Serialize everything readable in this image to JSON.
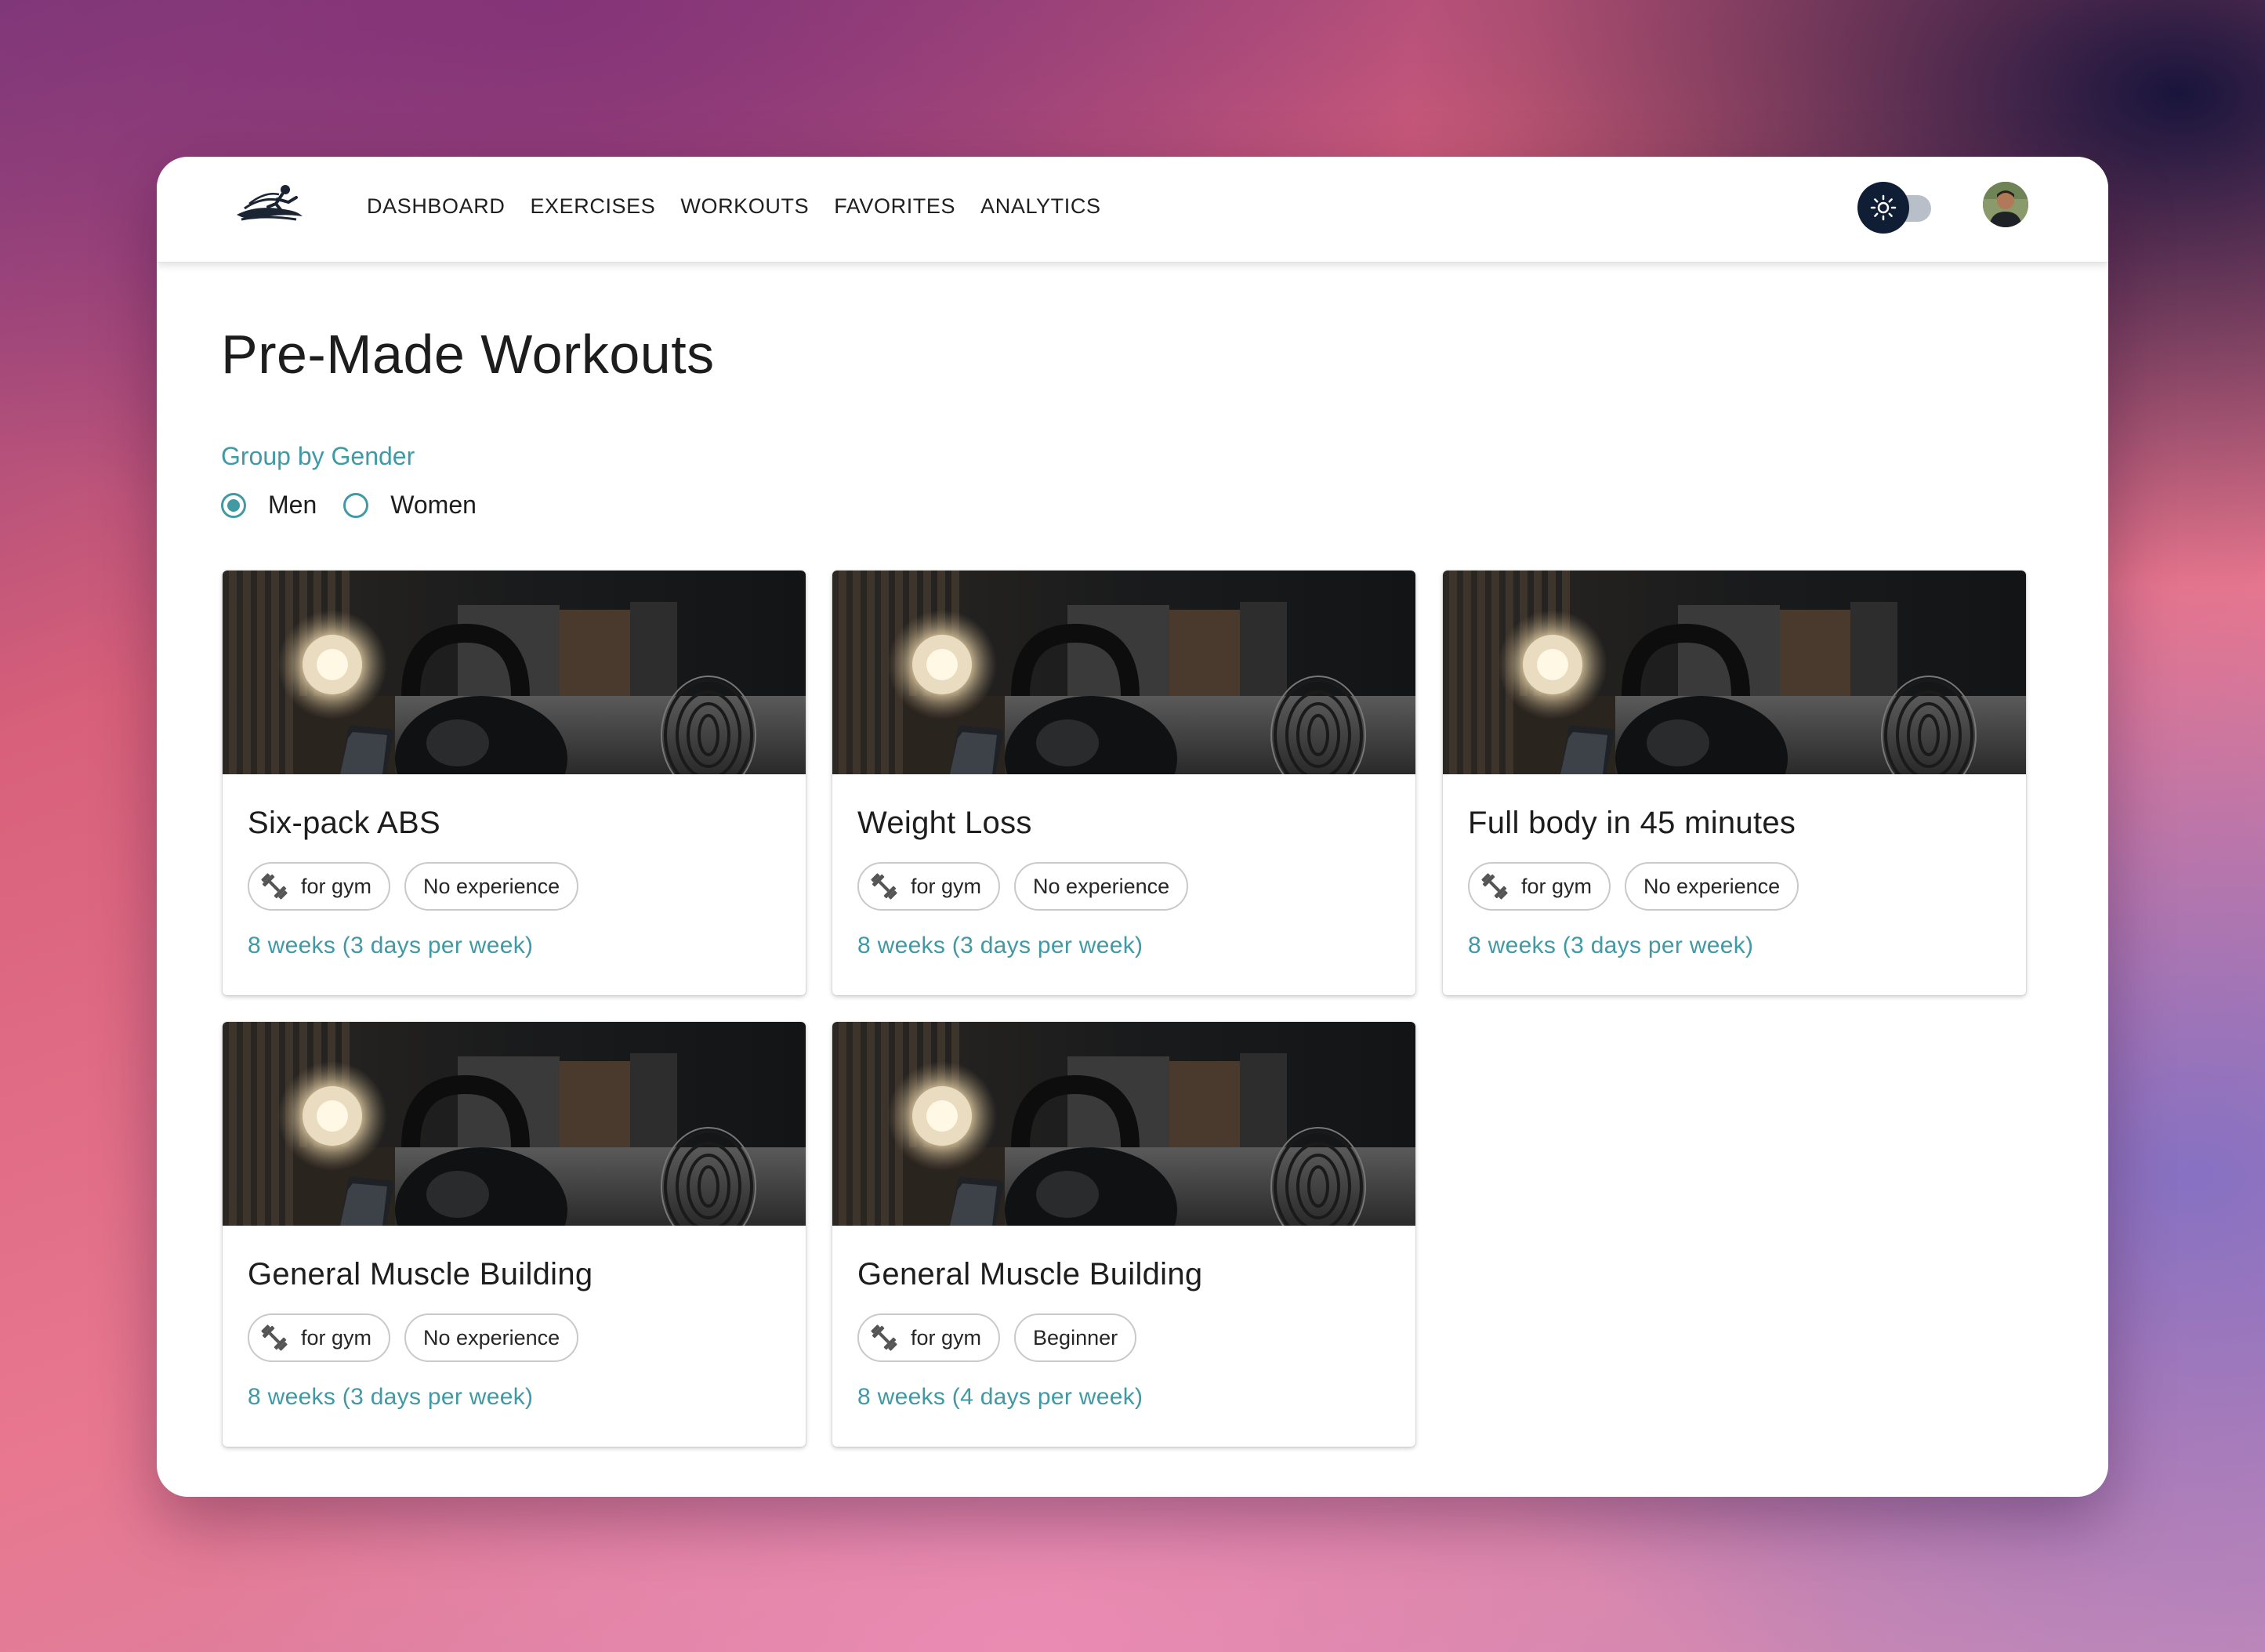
{
  "nav": {
    "items": [
      "DASHBOARD",
      "EXERCISES",
      "WORKOUTS",
      "FAVORITES",
      "ANALYTICS"
    ]
  },
  "page": {
    "title": "Pre-Made Workouts"
  },
  "filter": {
    "label": "Group by Gender",
    "options": [
      {
        "label": "Men",
        "selected": true
      },
      {
        "label": "Women",
        "selected": false
      }
    ]
  },
  "workouts": [
    {
      "title": "Six-pack ABS",
      "place": "for gym",
      "level": "No experience",
      "duration": "8 weeks (3 days per week)"
    },
    {
      "title": "Weight Loss",
      "place": "for gym",
      "level": "No experience",
      "duration": "8 weeks (3 days per week)"
    },
    {
      "title": "Full body in 45 minutes",
      "place": "for gym",
      "level": "No experience",
      "duration": "8 weeks (3 days per week)"
    },
    {
      "title": "General Muscle Building",
      "place": "for gym",
      "level": "No experience",
      "duration": "8 weeks (3 days per week)"
    },
    {
      "title": "General Muscle Building",
      "place": "for gym",
      "level": "Beginner",
      "duration": "8 weeks (4 days per week)"
    }
  ],
  "icons": {
    "logo": "runner-logo-icon",
    "theme": "sun-icon",
    "place": "dumbbell-icon"
  },
  "colors": {
    "accent": "#3f9aa4",
    "toggle_thumb": "#0f1e35",
    "text": "#1d1d1d"
  }
}
